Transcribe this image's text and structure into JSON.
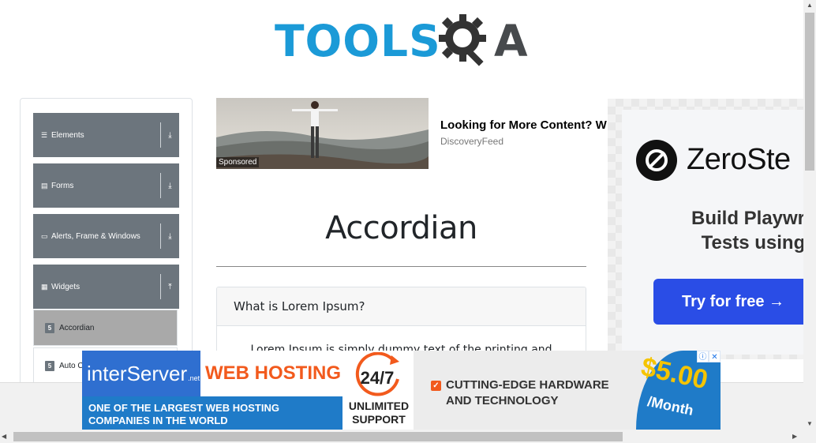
{
  "header": {
    "logo_tools": "TOOLS",
    "logo_qa_letter": "A"
  },
  "menu": {
    "groups": [
      {
        "label": "Elements",
        "icon": "hamburger-icon",
        "chevron": "⤓"
      },
      {
        "label": "Forms",
        "icon": "form-icon",
        "chevron": "⤓"
      },
      {
        "label": "Alerts, Frame & Windows",
        "icon": "window-icon",
        "chevron": "⤓"
      },
      {
        "label": "Widgets",
        "icon": "grid-icon",
        "chevron": "⤒"
      }
    ],
    "subitems": [
      {
        "label": "Accordian",
        "active": true
      },
      {
        "label": "Auto C",
        "active": false
      }
    ]
  },
  "sponsored": {
    "tag": "Sponsored",
    "title": "Looking for More Content? W",
    "source": "DiscoveryFeed"
  },
  "main": {
    "title": "Accordian",
    "section_heading": "What is Lorem Ipsum?",
    "section_body": "Lorem Ipsum is simply dummy text of the printing and"
  },
  "right_ad": {
    "brand": "ZeroSte",
    "tagline_line1": "Build Playwrigh",
    "tagline_line2": "Tests using A",
    "cta": "Try for free →",
    "accent": "#2a4de6"
  },
  "bottom_ad": {
    "brand": "interServer",
    "brand_suffix": ".net",
    "headline": "WEB HOSTING",
    "badge": "24/7",
    "sub_line1": "ONE OF THE LARGEST WEB HOSTING",
    "sub_line2": "COMPANIES IN THE WORLD",
    "support_line1": "UNLIMITED",
    "support_line2": "SUPPORT",
    "feature_line1": "CUTTING-EDGE HARDWARE",
    "feature_line2": "AND TECHNOLOGY",
    "price": "$5.00",
    "per": "/Month",
    "info_icon": "ⓘ",
    "close_icon": "✕"
  }
}
